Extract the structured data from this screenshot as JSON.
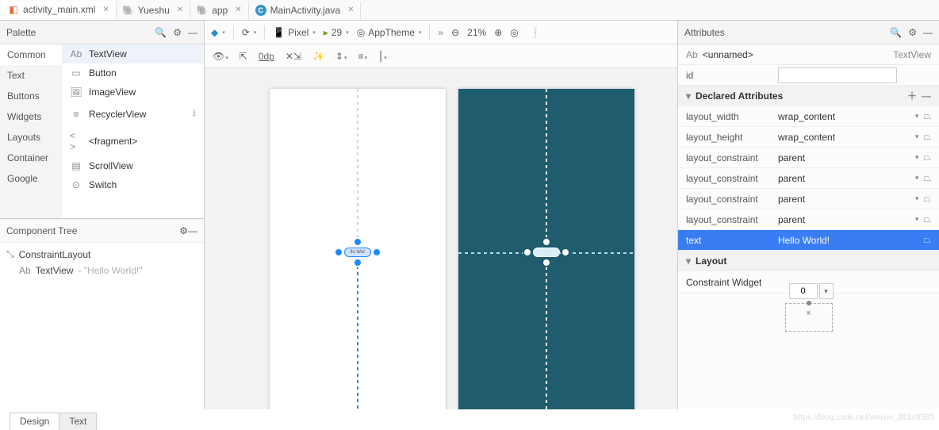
{
  "tabs": [
    {
      "label": "activity_main.xml",
      "active": true,
      "iconColor": "#e06c3b"
    },
    {
      "label": "Yueshu",
      "active": false,
      "iconColor": "#7a9e8b"
    },
    {
      "label": "app",
      "active": false,
      "iconColor": "#7a9e8b"
    },
    {
      "label": "MainActivity.java",
      "active": false,
      "iconColor": "#3a94c5",
      "iconLetter": "C"
    }
  ],
  "palette": {
    "title": "Palette",
    "categories": [
      "Common",
      "Text",
      "Buttons",
      "Widgets",
      "Layouts",
      "Container",
      "Google"
    ],
    "activeCat": "Common",
    "widgets": [
      {
        "label": "TextView",
        "icon": "Ab",
        "sel": true
      },
      {
        "label": "Button",
        "icon": "▭"
      },
      {
        "label": "ImageView",
        "icon": "🖼"
      },
      {
        "label": "RecyclerView",
        "icon": "≡",
        "dl": true
      },
      {
        "label": "<fragment>",
        "icon": "< >"
      },
      {
        "label": "ScrollView",
        "icon": "▤"
      },
      {
        "label": "Switch",
        "icon": "⊙"
      }
    ]
  },
  "componentTree": {
    "title": "Component Tree",
    "root": {
      "label": "ConstraintLayout",
      "icon": "⤡"
    },
    "child": {
      "icon": "Ab",
      "label": "TextView",
      "hint": "- \"Hello World!\""
    }
  },
  "editorTb": {
    "device": "Pixel",
    "api": "29",
    "theme": "AppTheme",
    "zoom": "21%",
    "autoconnect": "0dp"
  },
  "attributes": {
    "title": "Attributes",
    "unnamed": "<unnamed>",
    "type": "TextView",
    "idLabel": "id",
    "idValue": "",
    "declared": "Declared Attributes",
    "rows": [
      {
        "k": "layout_width",
        "v": "wrap_content"
      },
      {
        "k": "layout_height",
        "v": "wrap_content"
      },
      {
        "k": "layout_constraint",
        "v": "parent"
      },
      {
        "k": "layout_constraint",
        "v": "parent"
      },
      {
        "k": "layout_constraint",
        "v": "parent"
      },
      {
        "k": "layout_constraint",
        "v": "parent"
      }
    ],
    "selRow": {
      "k": "text",
      "v": "Hello World!"
    },
    "layoutHdr": "Layout",
    "constraintWidget": "Constraint Widget",
    "cbVal": "0"
  },
  "bottomTabs": [
    "Design",
    "Text"
  ],
  "chipText": "llo Wor"
}
